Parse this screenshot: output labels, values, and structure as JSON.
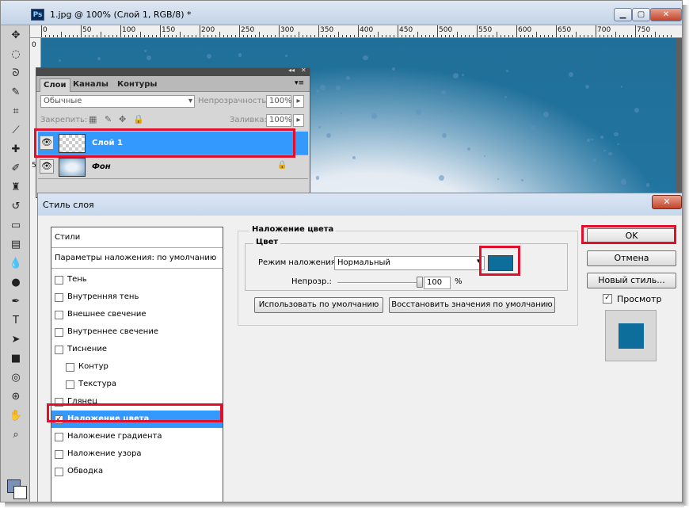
{
  "window": {
    "app_icon_text": "Ps",
    "title": "1.jpg @ 100% (Слой 1, RGB/8) *",
    "min_glyph": "▁",
    "max_glyph": "▢",
    "close_glyph": "✕"
  },
  "ruler": {
    "top_labels": [
      "0",
      "50",
      "100",
      "150",
      "200",
      "250",
      "300",
      "350",
      "400",
      "450",
      "500",
      "550",
      "600",
      "650",
      "700",
      "750"
    ],
    "left_labels": [
      "0",
      "5"
    ]
  },
  "layers_panel": {
    "collapse_glyph": "◂◂",
    "close_glyph": "✕",
    "menu_glyph": "▾≡",
    "tabs": [
      "Слои",
      "Каналы",
      "Контуры"
    ],
    "blend_mode": "Обычные",
    "opacity_label": "Непрозрачность:",
    "opacity_value": "100%",
    "lock_label": "Закрепить:",
    "fill_label": "Заливка:",
    "fill_value": "100%",
    "layers": [
      {
        "name": "Слой 1",
        "selected": true
      },
      {
        "name": "Фон",
        "selected": false
      }
    ]
  },
  "dialog": {
    "title": "Стиль слоя",
    "close_glyph": "✕",
    "styles_header": "Стили",
    "blending_options": "Параметры наложения: по умолчанию",
    "style_items": [
      {
        "label": "Тень",
        "checked": false,
        "indent": false
      },
      {
        "label": "Внутренняя тень",
        "checked": false,
        "indent": false
      },
      {
        "label": "Внешнее свечение",
        "checked": false,
        "indent": false
      },
      {
        "label": "Внутреннее свечение",
        "checked": false,
        "indent": false
      },
      {
        "label": "Тиснение",
        "checked": false,
        "indent": false
      },
      {
        "label": "Контур",
        "checked": false,
        "indent": true
      },
      {
        "label": "Текстура",
        "checked": false,
        "indent": true
      },
      {
        "label": "Глянец",
        "checked": false,
        "indent": false
      },
      {
        "label": "Наложение цвета",
        "checked": true,
        "indent": false,
        "selected": true
      },
      {
        "label": "Наложение градиента",
        "checked": false,
        "indent": false
      },
      {
        "label": "Наложение узора",
        "checked": false,
        "indent": false
      },
      {
        "label": "Обводка",
        "checked": false,
        "indent": false
      }
    ],
    "section_title": "Наложение цвета",
    "subsection_title": "Цвет",
    "blend_mode_label": "Режим наложения:",
    "blend_mode_value": "Нормальный",
    "overlay_color": "#0d6d9b",
    "opacity_label": "Непрозр.:",
    "opacity_value": "100",
    "opacity_unit": "%",
    "opacity_fraction": 1.0,
    "make_default_button": "Использовать по умолчанию",
    "reset_default_button": "Восстановить значения по умолчанию",
    "ok_button": "OK",
    "cancel_button": "Отмена",
    "new_style_button": "Новый стиль...",
    "preview_label": "Просмотр",
    "preview_checked": true,
    "preview_color": "#0d6d9b"
  },
  "highlight_color": "#e0102a",
  "check_glyph": "✓"
}
